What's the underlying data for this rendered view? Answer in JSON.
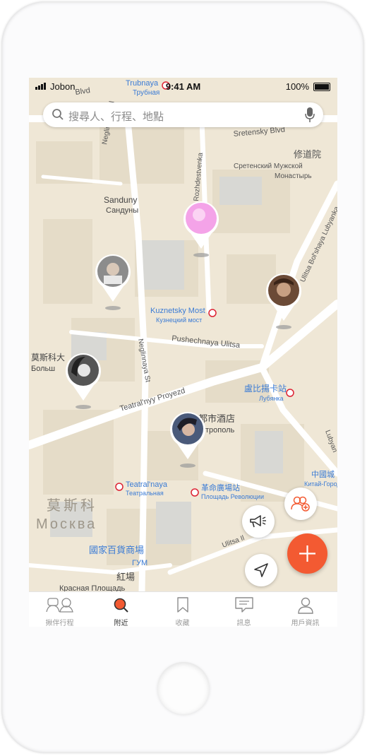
{
  "status_bar": {
    "carrier": "Jobon",
    "time": "9:41 AM",
    "battery": "100%"
  },
  "search": {
    "placeholder": "搜尋人、行程、地點"
  },
  "map": {
    "labels": [
      {
        "id": "trubnaya",
        "text": "Trubnaya"
      },
      {
        "id": "trubnaya-ru",
        "text": "Трубная"
      },
      {
        "id": "blvd",
        "text": "Blvd"
      },
      {
        "id": "sretensky-blvd",
        "text": "Sretensky Blvd"
      },
      {
        "id": "monastery-zh",
        "text": "修道院"
      },
      {
        "id": "monastery-ru1",
        "text": "Сретенский Мужской"
      },
      {
        "id": "monastery-ru2",
        "text": "Монастырь"
      },
      {
        "id": "neglinnaya-ul",
        "text": "Neglinnaya Ul"
      },
      {
        "id": "rozhdestvenka",
        "text": "Rozhdestvenka"
      },
      {
        "id": "sanduny",
        "text": "Sanduny"
      },
      {
        "id": "sanduny-ru",
        "text": "Сандуны"
      },
      {
        "id": "bolshaya-lubyanka",
        "text": "Ulitsa Bol'shaya Lubyanka"
      },
      {
        "id": "kuznetsky",
        "text": "Kuznetsky Most"
      },
      {
        "id": "kuznetsky-ru",
        "text": "Кузнецкий мост"
      },
      {
        "id": "pushechnaya",
        "text": "Pushechnaya Ulitsa"
      },
      {
        "id": "neglinnaya-st",
        "text": "Neglinnaya St"
      },
      {
        "id": "bolshoi-zh",
        "text": "莫斯科大"
      },
      {
        "id": "bolshoi-ru",
        "text": "Больш"
      },
      {
        "id": "lubyanka-zh",
        "text": "盧比揚卡站"
      },
      {
        "id": "lubyanka-ru",
        "text": "Лубянка"
      },
      {
        "id": "teatralny-proyezd",
        "text": "Teatral'nyy Proyezd"
      },
      {
        "id": "metropol-zh",
        "text": "都市酒店"
      },
      {
        "id": "metropol-ru",
        "text": "трополь"
      },
      {
        "id": "lubyan",
        "text": "Lubyan"
      },
      {
        "id": "china-zh",
        "text": "中國城"
      },
      {
        "id": "china-ru",
        "text": "Китай-Город"
      },
      {
        "id": "teatralnaya",
        "text": "Teatral'naya"
      },
      {
        "id": "teatralnaya-ru",
        "text": "Театральная"
      },
      {
        "id": "revolution-zh",
        "text": "革命廣場站"
      },
      {
        "id": "revolution-ru",
        "text": "Площадь Революции"
      },
      {
        "id": "moscow-zh",
        "text": "莫斯科"
      },
      {
        "id": "moscow-ru",
        "text": "Москва"
      },
      {
        "id": "gum-zh",
        "text": "國家百貨商場"
      },
      {
        "id": "gum-ru",
        "text": "ГУМ"
      },
      {
        "id": "ilinka",
        "text": "Ulitsa Il"
      },
      {
        "id": "red-square-zh",
        "text": "紅場"
      },
      {
        "id": "red-square-ru",
        "text": "Красная Площадь"
      }
    ],
    "pins": [
      {
        "id": "pin-pink",
        "avatar_color": "#f4a3e8"
      },
      {
        "id": "pin-woman",
        "avatar_color": "#8c8c8c"
      },
      {
        "id": "pin-man",
        "avatar_color": "#6b4a36"
      },
      {
        "id": "pin-woman2",
        "avatar_color": "#555555"
      },
      {
        "id": "pin-woman3",
        "avatar_color": "#4a5a7a"
      }
    ]
  },
  "tabs": [
    {
      "id": "trips",
      "label": "揪伴行程",
      "active": false
    },
    {
      "id": "nearby",
      "label": "附近",
      "active": true
    },
    {
      "id": "saved",
      "label": "收藏",
      "active": false
    },
    {
      "id": "messages",
      "label": "訊息",
      "active": false
    },
    {
      "id": "profile",
      "label": "用戶資訊",
      "active": false
    }
  ],
  "colors": {
    "accent": "#f35a32",
    "map_bg": "#efe9dc",
    "road": "#ffffff",
    "transit": "#3a7bd5"
  }
}
